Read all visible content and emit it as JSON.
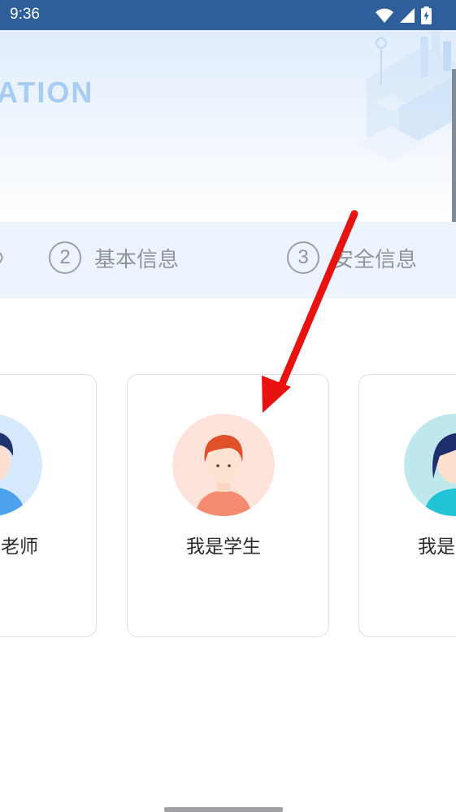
{
  "status_bar": {
    "time": "9:36",
    "icons": [
      "wifi-icon",
      "signal-icon",
      "battery-charging-icon"
    ]
  },
  "banner": {
    "title": "ATION"
  },
  "steps": {
    "items": [
      {
        "number": "2",
        "label": "基本信息"
      },
      {
        "number": "3",
        "label": "安全信息"
      }
    ]
  },
  "roles": {
    "teacher_label": "老师",
    "student_label": "我是学生",
    "parent_label": "我是"
  },
  "colors": {
    "status_bar": "#2f5f9b",
    "banner_title": "#a8cdf2",
    "steps_bg": "#eef4fd",
    "arrow": "#e8120f",
    "card_border": "#dcdfe3"
  }
}
